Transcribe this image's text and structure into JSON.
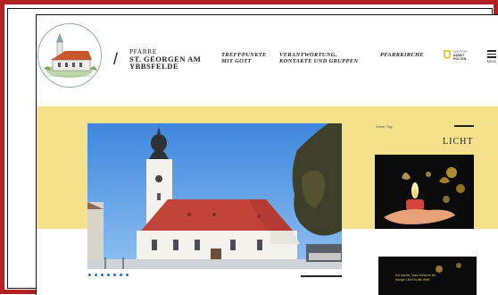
{
  "header": {
    "brand_line1": "PFARRE",
    "brand_line2": "ST. GEORGEN AM",
    "brand_line3": "YBBSFELDE",
    "divider": "/"
  },
  "nav": [
    {
      "line1": "TREFFPUNKTE",
      "line2": "MIT GOTT"
    },
    {
      "line1": "VERANTWORTUNG,",
      "line2": "KONTAKTE UND GRUPPEN"
    },
    {
      "line1": "PFARRKIRCHE",
      "line2": ""
    }
  ],
  "diocese": {
    "line1": "DIÖZESE",
    "line2": "SANKT",
    "line3": "PÖLTEN"
  },
  "menu": {
    "label": "MENÜ"
  },
  "aside": {
    "label": "Unser Tipp",
    "title": "LICHT"
  },
  "card2": {
    "caption_line1": "Ich suche, was verloren ist,",
    "caption_line2": "bringe Licht in die Welt."
  },
  "slider": {
    "count": 7,
    "active": 1
  },
  "colors": {
    "frame": "#b22222",
    "band": "#f5e08c",
    "dot": "#1c74c9"
  }
}
